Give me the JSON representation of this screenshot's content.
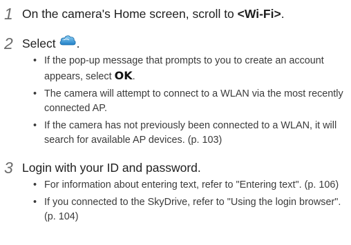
{
  "steps": [
    {
      "number": "1",
      "text_prefix": "On the camera's Home screen, scroll to ",
      "text_bold": "<Wi-Fi>",
      "text_suffix": "."
    },
    {
      "number": "2",
      "text_prefix": "Select",
      "icon": "skydrive-cloud-icon",
      "text_suffix": ".",
      "bullets": [
        {
          "prefix": "If the pop-up message that prompts to you to create an account appears, select ",
          "bold": "OK",
          "suffix": "."
        },
        {
          "text": "The camera will attempt to connect to a WLAN via the most recently connected AP."
        },
        {
          "text": "If the camera has not previously been connected to a WLAN, it will search for available AP devices. (p. 103)"
        }
      ]
    },
    {
      "number": "3",
      "text_prefix": "Login with your ID and password.",
      "bullets": [
        {
          "text": "For information about entering text, refer to \"Entering text\". (p. 106)"
        },
        {
          "text": "If you connected to the SkyDrive, refer to \"Using the login browser\". (p. 104)"
        }
      ]
    }
  ]
}
